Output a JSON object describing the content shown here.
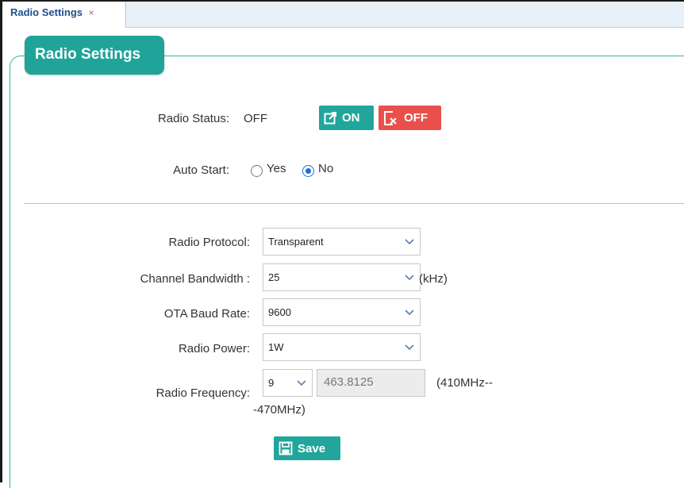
{
  "tab": {
    "label": "Radio Settings",
    "close": "×"
  },
  "panel": {
    "title": "Radio Settings"
  },
  "radio_status": {
    "label": "Radio Status:",
    "value": "OFF",
    "on_label": "ON",
    "off_label": "OFF"
  },
  "auto_start": {
    "label": "Auto Start:",
    "options": [
      "Yes",
      "No"
    ],
    "selected": "No"
  },
  "radio_protocol": {
    "label": "Radio Protocol:",
    "value": "Transparent"
  },
  "channel_bandwidth": {
    "label": "Channel Bandwidth :",
    "value": "25",
    "unit": "(kHz)"
  },
  "ota_baud_rate": {
    "label": "OTA Baud Rate:",
    "value": "9600"
  },
  "radio_power": {
    "label": "Radio Power:",
    "value": "1W"
  },
  "radio_frequency": {
    "label": "Radio Frequency:",
    "channel": "9",
    "frequency": "463.8125",
    "range_part1": "(410MHz--",
    "range_part2": "-470MHz)"
  },
  "save": {
    "label": "Save"
  },
  "colors": {
    "accent": "#22a69c",
    "danger": "#e9504b",
    "radio_checked": "#1e6fd6"
  },
  "icons": {
    "on": "edit-icon",
    "off": "close-box-icon",
    "save": "floppy-icon",
    "dropdown": "chevron-down-icon"
  }
}
